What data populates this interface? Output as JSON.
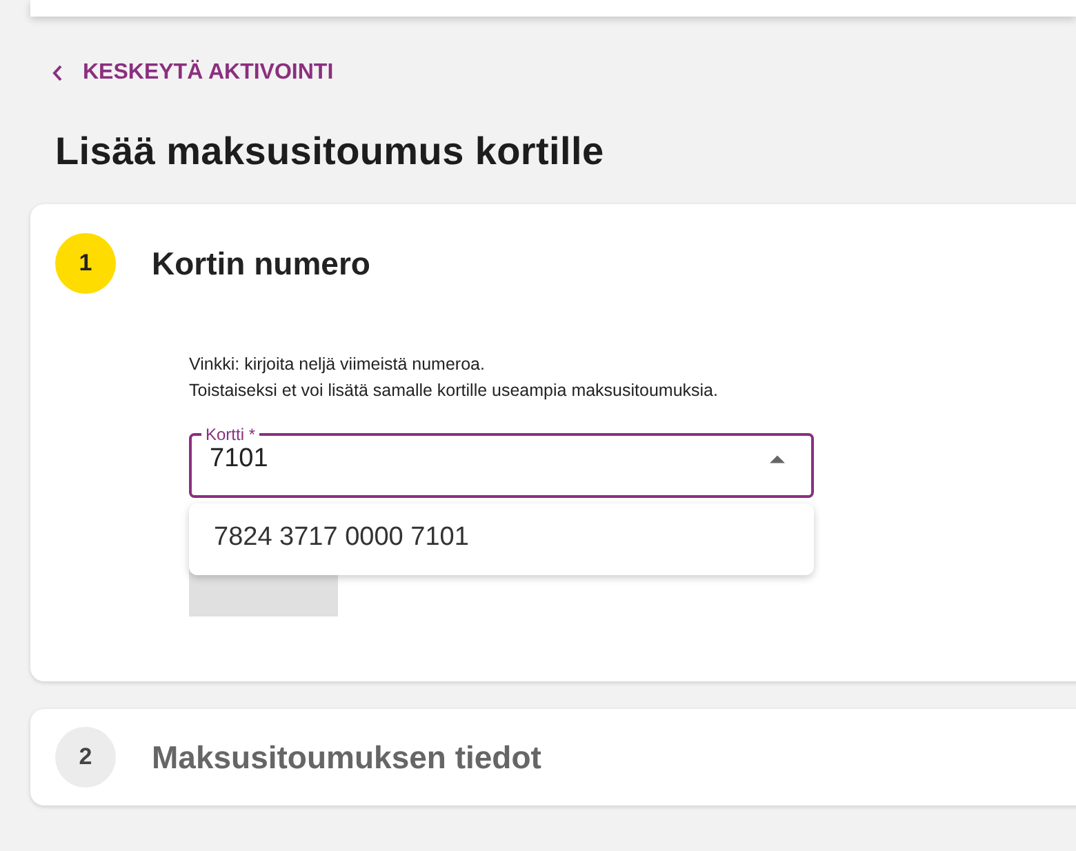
{
  "back_link": {
    "label": "KESKEYTÄ AKTIVOINTI"
  },
  "title": "Lisää maksusitoumus kortille",
  "steps": [
    {
      "number": "1",
      "title": "Kortin numero",
      "active": true,
      "hints": [
        "Vinkki: kirjoita neljä viimeistä numeroa.",
        "Toistaiseksi et voi lisätä samalle kortille useampia maksusitoumuksia."
      ],
      "field": {
        "label": "Kortti *",
        "value": "7101",
        "expanded": true,
        "options": [
          {
            "label": "7824 3717 0000 7101",
            "selected": false
          }
        ]
      },
      "button": {
        "disabled": true
      }
    },
    {
      "number": "2",
      "title": "Maksusitoumuksen tiedot",
      "active": false
    }
  ]
}
